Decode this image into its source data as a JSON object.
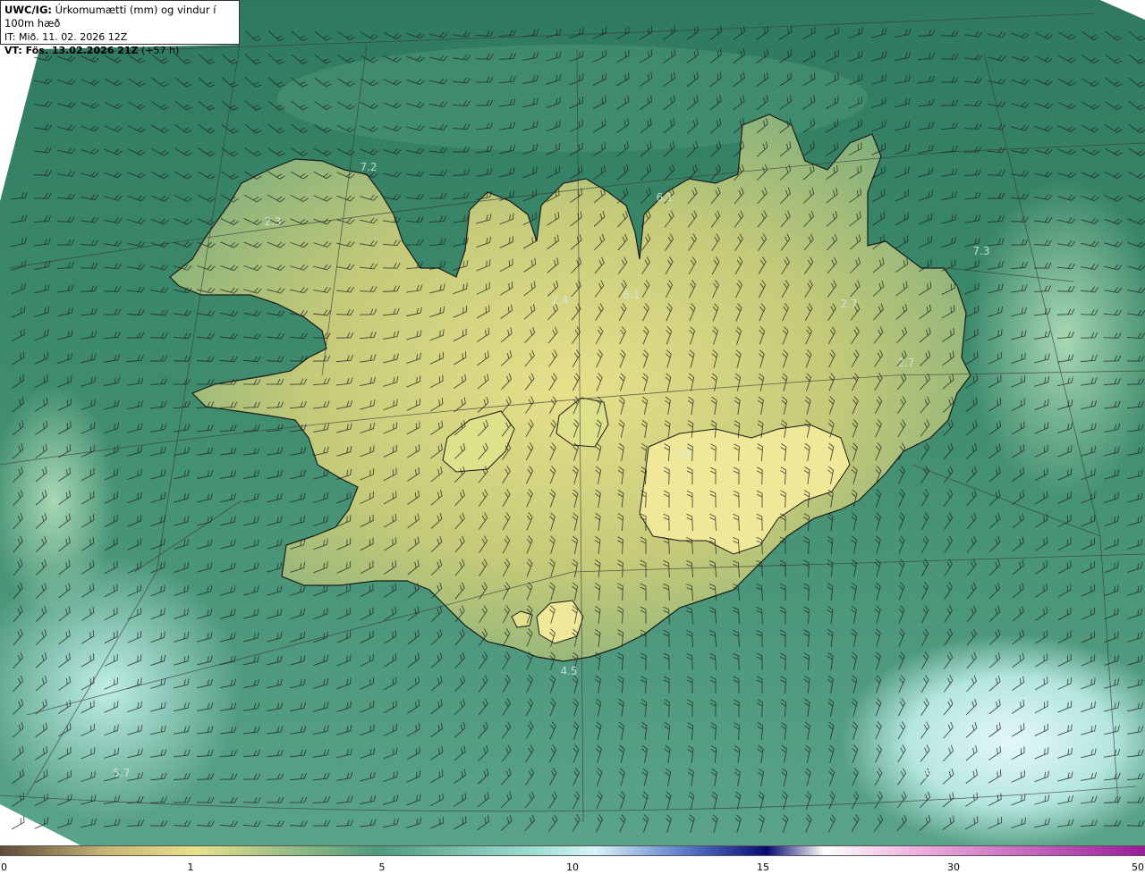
{
  "header": {
    "title_prefix": "UWC/IG:",
    "title_text": "Úrkomumætti (mm) og vindur í 100m hæð",
    "init_time": "IT: Mið. 11. 02. 2026 12Z",
    "valid_prefix": "VT: Fös. 13.02.2026 21Z",
    "valid_suffix": "(+57 h)"
  },
  "colorbar": {
    "ticks": [
      "0",
      "1",
      "5",
      "10",
      "15",
      "30",
      "50"
    ],
    "colors": {
      "c0": "#5b4a3a",
      "c1": "#c7b374",
      "c2": "#e9e28c",
      "c3": "#4e9a7c",
      "c4": "#9fe0d6",
      "c5": "#d9f4f8",
      "c6": "#5878c8",
      "c7": "#0a0a70",
      "c8": "#f0b0e0",
      "c9": "#9a1a9a"
    }
  },
  "map_values": [
    "7.2",
    "2.3",
    "6.1",
    "7.3",
    "2.4",
    "6.1",
    "2.7",
    "2.7",
    "1.6",
    "4.5",
    "5.7",
    "5.5"
  ],
  "colors": {
    "land": "#c9d27e",
    "sea": "#3f8a6d",
    "sea_light": "#a6dfd4",
    "coast": "#1a1a1a",
    "grid": "#3a3a3a"
  }
}
